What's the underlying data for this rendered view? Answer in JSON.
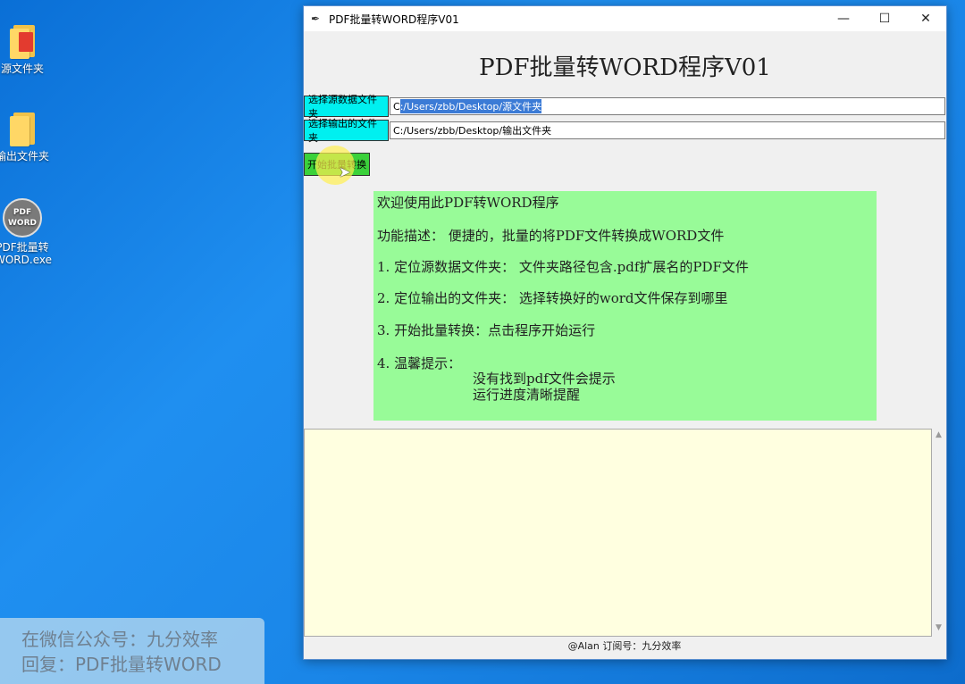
{
  "desktop": {
    "icons": [
      {
        "label": "源文件夹"
      },
      {
        "label": "输出文件夹"
      },
      {
        "label": "PDF批量转\nWORD.exe",
        "badge_top": "PDF",
        "badge_bottom": "WORD"
      }
    ]
  },
  "window": {
    "title": "PDF批量转WORD程序V01",
    "controls": {
      "minimize": "—",
      "maximize": "☐",
      "close": "✕"
    },
    "app_title": "PDF批量转WORD程序V01",
    "source_button": "选择源数据文件夹",
    "source_path_selected": "C:/Users/zbb/Desktop/源文件夹",
    "source_path_first": "C",
    "source_path_rest": ":/Users/zbb/Desktop/源文件夹",
    "output_button": "选择输出的文件夹",
    "output_path": "C:/Users/zbb/Desktop/输出文件夹",
    "start_button": "开始批量转换",
    "info": {
      "welcome": "欢迎使用此PDF转WORD程序",
      "desc": "功能描述：  便捷的，批量的将PDF文件转换成WORD文件",
      "step1": "1.  定位源数据文件夹：  文件夹路径包含.pdf扩展名的PDF文件",
      "step2": "2.  定位输出的文件夹：  选择转换好的word文件保存到哪里",
      "step3": "3.  开始批量转换：点击程序开始运行",
      "step4": "4.  温馨提示：",
      "tip1": "没有找到pdf文件会提示",
      "tip2": "运行进度清晰提醒"
    },
    "footer": "@Alan  订阅号：九分效率"
  },
  "watermark": {
    "line1": "在微信公众号：九分效率",
    "line2": "回复：PDF批量转WORD"
  }
}
